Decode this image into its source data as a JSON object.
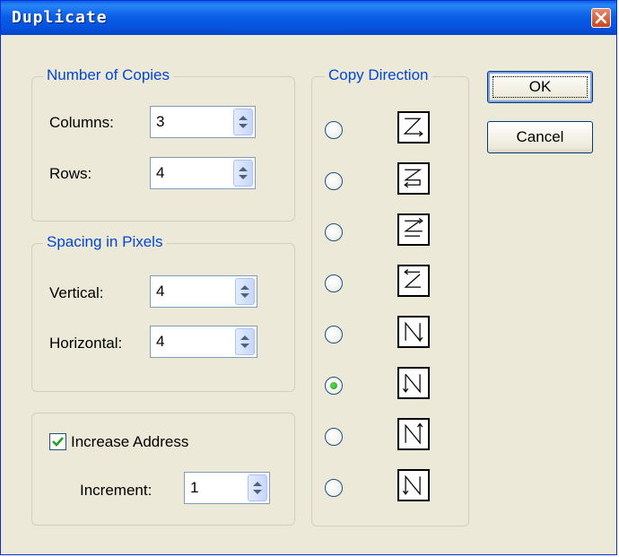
{
  "window": {
    "title": "Duplicate"
  },
  "copies": {
    "title": "Number of Copies",
    "columns_label": "Columns:",
    "columns_value": "3",
    "rows_label": "Rows:",
    "rows_value": "4"
  },
  "spacing": {
    "title": "Spacing in Pixels",
    "vertical_label": "Vertical:",
    "vertical_value": "4",
    "horizontal_label": "Horizontal:",
    "horizontal_value": "4"
  },
  "address": {
    "checkbox_label": "Increase Address",
    "checked": true,
    "increment_label": "Increment:",
    "increment_value": "1"
  },
  "direction": {
    "title": "Copy Direction",
    "options": [
      {
        "icon": "z-right-icon",
        "selected": false
      },
      {
        "icon": "z-left-bottom-icon",
        "selected": false
      },
      {
        "icon": "z-right-top-icon",
        "selected": false
      },
      {
        "icon": "z-left-top-icon",
        "selected": false
      },
      {
        "icon": "n-down-right-icon",
        "selected": false
      },
      {
        "icon": "n-down-left-icon",
        "selected": true
      },
      {
        "icon": "n-up-right-icon",
        "selected": false
      },
      {
        "icon": "n-down-left-alt-icon",
        "selected": false
      }
    ]
  },
  "buttons": {
    "ok_label": "OK",
    "cancel_label": "Cancel"
  },
  "colors": {
    "title_blue": "#0a5fe4",
    "group_title": "#0046d5",
    "dialog_bg": "#ece9d8"
  }
}
